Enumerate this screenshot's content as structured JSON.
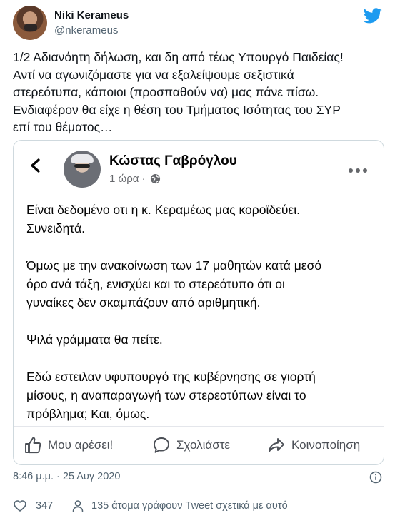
{
  "author": {
    "name": "Niki Kerameus",
    "handle": "@nkerameus"
  },
  "tweet": {
    "text": "1/2 Αδιανόητη δήλωση, και δη από τέως Υπουργό Παιδείας!\nΑντί να αγωνιζόμαστε για να εξαλείψουμε σεξιστικά\nστερεότυπα, κάποιοι (προσπαθούν να) μας πάνε πίσω.\nΕνδιαφέρον θα είχε η θέση του Τμήματος Ισότητας του ΣΥΡ\nεπί του θέματος…",
    "timestamp": "8:46 μ.μ. · 25 Αυγ 2020",
    "likes": "347",
    "talking_about": "135 άτομα γράφουν Tweet σχετικά με αυτό"
  },
  "embedded_post": {
    "author_name": "Κώστας Γαβρόγλου",
    "time": "1 ώρα ·",
    "body": "Είναι δεδομένο οτι η κ. Κεραμέως μας κοροϊδεύει.\nΣυνειδητά.\n\nΌμως με την ανακοίνωση των 17 μαθητών κατά μεσό\nόρο ανά τάξη, ενισχύει και το στερεότυπο ότι οι\nγυναίκες δεν σκαμπάζουν από αριθμητική.\n\nΨιλά γράμματα θα πείτε.\n\nΕδώ εστειλαν υφυπουργό της κυβέρνησης σε γιορτή\nμίσους, η αναπαραγωγή των στερεοτύπων είναι το\nπρόβλημα; Και, όμως.",
    "actions": {
      "like": "Μου αρέσει!",
      "comment": "Σχολιάστε",
      "share": "Κοινοποίηση"
    }
  },
  "icons": {
    "brand": "twitter-bird-icon",
    "brand_color": "#1d9bf0",
    "secondary_text_color": "#536471"
  }
}
